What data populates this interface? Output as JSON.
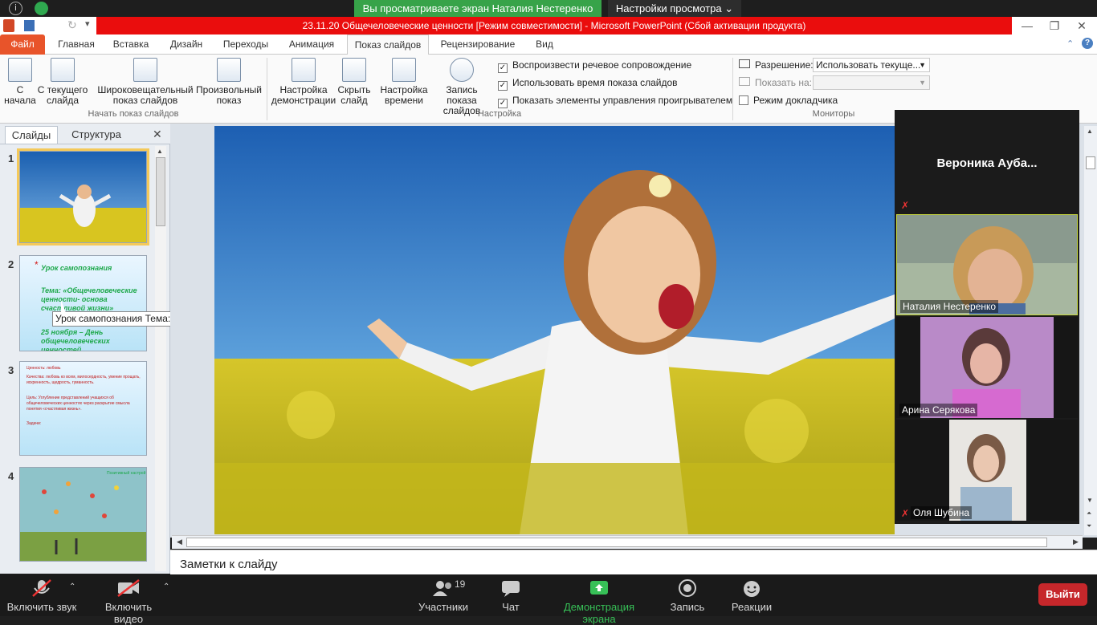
{
  "zoom": {
    "banner_text": "Вы просматриваете экран Наталия Нестеренко",
    "view_options_label": "Настройки просмотра",
    "toolbar": {
      "unmute_label": "Включить звук",
      "start_video_label": "Включить видео",
      "participants_label": "Участники",
      "participants_count": "19",
      "chat_label": "Чат",
      "share_label": "Демонстрация экрана",
      "record_label": "Запись",
      "reactions_label": "Реакции",
      "leave_label": "Выйти"
    },
    "participants": [
      {
        "name": "Вероника  Ауба...",
        "muted": true,
        "video": false
      },
      {
        "name": "Наталия Нестеренко",
        "muted": false,
        "video": true
      },
      {
        "name": "Арина Серякова",
        "muted": false,
        "video": true
      },
      {
        "name": "Оля Шубина",
        "muted": true,
        "video": true
      }
    ],
    "colors": {
      "share_green": "#37a349",
      "leave_red": "#c6272b"
    }
  },
  "ppt": {
    "window_title": "23.11.20 Общечеловеческие ценности [Режим совместимости]  -  Microsoft PowerPoint (Сбой активации продукта)",
    "tabs": [
      "Файл",
      "Главная",
      "Вставка",
      "Дизайн",
      "Переходы",
      "Анимация",
      "Показ слайдов",
      "Рецензирование",
      "Вид"
    ],
    "active_tab": "Показ слайдов",
    "ribbon": {
      "start_group": {
        "label": "Начать показ слайдов",
        "buttons": [
          "С начала",
          "С текущего слайда",
          "Широковещательный показ слайдов",
          "Произвольный показ"
        ]
      },
      "setup_group": {
        "label": "Настройка",
        "buttons": [
          "Настройка демонстрации",
          "Скрыть слайд",
          "Настройка времени",
          "Запись показа слайдов"
        ],
        "checks": [
          {
            "label": "Воспроизвести речевое сопровождение",
            "checked": true
          },
          {
            "label": "Использовать время показа слайдов",
            "checked": true
          },
          {
            "label": "Показать элементы управления проигрывателем",
            "checked": true
          }
        ]
      },
      "monitors_group": {
        "label": "Мониторы",
        "resolution_label": "Разрешение:",
        "resolution_value": "Использовать текуще...",
        "show_on_label": "Показать на:",
        "presenter_view_label": "Режим докладчика",
        "presenter_view_checked": false
      }
    },
    "panel_tabs": {
      "slides": "Слайды",
      "outline": "Структура"
    },
    "slides": [
      {
        "number": "1"
      },
      {
        "number": "2",
        "lines": [
          "Урок самопознания",
          "Тема: «Общечеловеческие ценности- основа счастливой жизни»",
          "25 ноября – День общечеловеческих ценностей"
        ]
      },
      {
        "number": "3",
        "lines": [
          "Ценность: любовь",
          "Качества: любовь ко всем, милосердность, умение прощать, искренность, щедрость, гуманность.",
          "Цель: Углубление представлений учащихся об общечеловеческих ценностях через раскрытие смысла понятия «счастливая жизнь».",
          "Задачи:"
        ]
      },
      {
        "number": "4",
        "lines": [
          "Позитивный настрой"
        ]
      }
    ],
    "tooltip": "Урок самопознания   Тема: «...",
    "notes_placeholder": "Заметки к слайду"
  }
}
